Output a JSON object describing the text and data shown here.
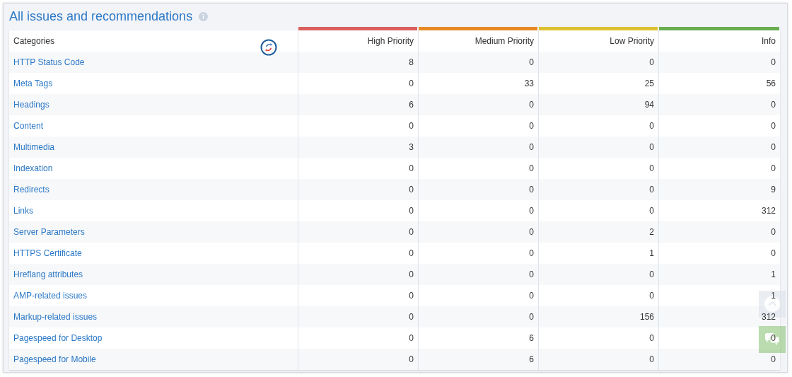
{
  "title": "All issues and recommendations",
  "columns": [
    {
      "label": "Categories"
    },
    {
      "label": "High Priority",
      "color": "#d9605f"
    },
    {
      "label": "Medium Priority",
      "color": "#e68a26"
    },
    {
      "label": "Low Priority",
      "color": "#dcc232"
    },
    {
      "label": "Info",
      "color": "#6aae52"
    }
  ],
  "rows": [
    {
      "category": "HTTP Status Code",
      "values": [
        "8",
        "0",
        "0",
        "0"
      ]
    },
    {
      "category": "Meta Tags",
      "values": [
        "0",
        "33",
        "25",
        "56"
      ]
    },
    {
      "category": "Headings",
      "values": [
        "6",
        "0",
        "94",
        "0"
      ]
    },
    {
      "category": "Content",
      "values": [
        "0",
        "0",
        "0",
        "0"
      ]
    },
    {
      "category": "Multimedia",
      "values": [
        "3",
        "0",
        "0",
        "0"
      ]
    },
    {
      "category": "Indexation",
      "values": [
        "0",
        "0",
        "0",
        "0"
      ]
    },
    {
      "category": "Redirects",
      "values": [
        "0",
        "0",
        "0",
        "9"
      ]
    },
    {
      "category": "Links",
      "values": [
        "0",
        "0",
        "0",
        "312"
      ]
    },
    {
      "category": "Server Parameters",
      "values": [
        "0",
        "0",
        "2",
        "0"
      ]
    },
    {
      "category": "HTTPS Certificate",
      "values": [
        "0",
        "0",
        "1",
        "0"
      ]
    },
    {
      "category": "Hreflang attributes",
      "values": [
        "0",
        "0",
        "0",
        "1"
      ]
    },
    {
      "category": "AMP-related issues",
      "values": [
        "0",
        "0",
        "0",
        "1"
      ]
    },
    {
      "category": "Markup-related issues",
      "values": [
        "0",
        "0",
        "156",
        "312"
      ]
    },
    {
      "category": "Pagespeed for Desktop",
      "values": [
        "0",
        "6",
        "0",
        "0"
      ]
    },
    {
      "category": "Pagespeed for Mobile",
      "values": [
        "0",
        "6",
        "0",
        "0"
      ]
    }
  ]
}
